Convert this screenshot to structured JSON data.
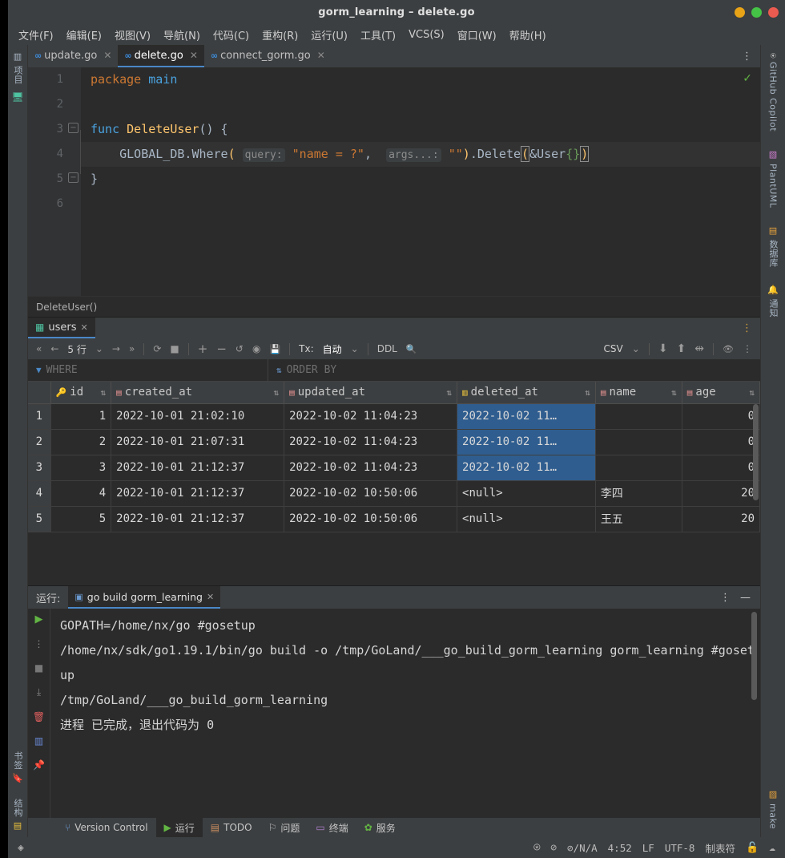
{
  "window": {
    "title": "gorm_learning – delete.go",
    "buttons": [
      "minimize",
      "maximize",
      "close"
    ]
  },
  "menubar": {
    "items": [
      {
        "label": "文件(F)"
      },
      {
        "label": "编辑(E)"
      },
      {
        "label": "视图(V)"
      },
      {
        "label": "导航(N)"
      },
      {
        "label": "代码(C)"
      },
      {
        "label": "重构(R)"
      },
      {
        "label": "运行(U)"
      },
      {
        "label": "工具(T)"
      },
      {
        "label": "VCS(S)"
      },
      {
        "label": "窗口(W)"
      },
      {
        "label": "帮助(H)"
      }
    ]
  },
  "left_toolbar": {
    "top_label": "项目",
    "bottom_labels": [
      "书签",
      "结构"
    ]
  },
  "right_toolbar": {
    "items": [
      "GitHub Copilot",
      "PlantUML",
      "数据库",
      "通知"
    ],
    "bottom": [
      "make"
    ]
  },
  "editor": {
    "tabs": [
      {
        "label": "update.go",
        "active": false
      },
      {
        "label": "delete.go",
        "active": true
      },
      {
        "label": "connect_gorm.go",
        "active": false
      }
    ],
    "more_label": "⋮",
    "lines": [
      "1",
      "2",
      "3",
      "4",
      "5",
      "6"
    ],
    "code": {
      "l1_kw": "package",
      "l1_id": "main",
      "l3_kw": "func",
      "l3_fn": "DeleteUser",
      "l3_paren": "() {",
      "l4_recv": "GLOBAL_DB",
      "l4_dot1": ".",
      "l4_where": "Where",
      "l4_open": "(",
      "l4_hint1": "query:",
      "l4_str1": "\"name = ?\"",
      "l4_comma": ",",
      "l4_hint2": "args...:",
      "l4_str2": "\"\"",
      "l4_close": ")",
      "l4_dot2": ".",
      "l4_delete": "Delete",
      "l4_open2": "(",
      "l4_arg": "&User",
      "l4_braces": "{}",
      "l4_close2": ")",
      "l5_brace": "}"
    },
    "breadcrumb": "DeleteUser()"
  },
  "database": {
    "tab": {
      "label": "users",
      "icon": "table-icon"
    },
    "toolbar": {
      "first": "«",
      "prev": "←",
      "rowcount": "5 行",
      "rowcount_caret": "⌄",
      "next": "→",
      "last": "»",
      "refresh": "⟳",
      "stop": "■",
      "add": "+",
      "remove": "−",
      "revert": "↺",
      "view": "◉",
      "save": "💾",
      "tx_label": "Tx:",
      "tx_value": "自动",
      "tx_caret": "⌄",
      "ddl": "DDL",
      "search": "🔍",
      "format": "CSV",
      "format_caret": "⌄",
      "download": "⬇",
      "upload": "⬆",
      "compare": "⇹",
      "eye": "👁",
      "more": "⋮"
    },
    "filters": {
      "where_label": "WHERE",
      "orderby_label": "ORDER BY"
    },
    "columns": [
      {
        "name": "id",
        "icon": "key-icon"
      },
      {
        "name": "created_at",
        "icon": "column-icon"
      },
      {
        "name": "updated_at",
        "icon": "column-icon"
      },
      {
        "name": "deleted_at",
        "icon": "indexed-column-icon"
      },
      {
        "name": "name",
        "icon": "column-icon"
      },
      {
        "name": "age",
        "icon": "column-icon"
      }
    ],
    "rows": [
      {
        "n": "1",
        "id": "1",
        "created_at": "2022-10-01 21:02:10",
        "updated_at": "2022-10-02 11:04:23",
        "deleted_at": "2022-10-02 11…",
        "deleted_selected": true,
        "name": "",
        "age": "0"
      },
      {
        "n": "2",
        "id": "2",
        "created_at": "2022-10-01 21:07:31",
        "updated_at": "2022-10-02 11:04:23",
        "deleted_at": "2022-10-02 11…",
        "deleted_selected": true,
        "name": "",
        "age": "0"
      },
      {
        "n": "3",
        "id": "3",
        "created_at": "2022-10-01 21:12:37",
        "updated_at": "2022-10-02 11:04:23",
        "deleted_at": "2022-10-02 11…",
        "deleted_selected": true,
        "name": "",
        "age": "0"
      },
      {
        "n": "4",
        "id": "4",
        "created_at": "2022-10-01 21:12:37",
        "updated_at": "2022-10-02 10:50:06",
        "deleted_at": "<null>",
        "deleted_selected": false,
        "name": "李四",
        "age": "20"
      },
      {
        "n": "5",
        "id": "5",
        "created_at": "2022-10-01 21:12:37",
        "updated_at": "2022-10-02 10:50:06",
        "deleted_at": "<null>",
        "deleted_selected": false,
        "name": "王五",
        "age": "20"
      }
    ]
  },
  "run": {
    "label": "运行:",
    "tab_label": "go build gorm_learning",
    "more": "⋮",
    "minimize": "—",
    "console_lines": [
      "GOPATH=/home/nx/go #gosetup",
      "/home/nx/sdk/go1.19.1/bin/go build -o /tmp/GoLand/___go_build_gorm_learning gorm_learning #gosetup",
      "/tmp/GoLand/___go_build_gorm_learning",
      "",
      "进程 已完成，退出代码为 0"
    ]
  },
  "toolwindow_bar": {
    "items": [
      {
        "label": "Version Control",
        "icon": "branch-icon",
        "active": false
      },
      {
        "label": "运行",
        "icon": "play-icon",
        "active": true
      },
      {
        "label": "TODO",
        "icon": "todo-icon",
        "active": false
      },
      {
        "label": "问题",
        "icon": "problems-icon",
        "active": false
      },
      {
        "label": "终端",
        "icon": "terminal-icon",
        "active": false
      },
      {
        "label": "服务",
        "icon": "services-icon",
        "active": false
      }
    ]
  },
  "statusbar": {
    "left_icon": "stack-icon",
    "right": {
      "copilot": "github-copilot-icon",
      "inspection": "⊘",
      "errors": "⊘/N/A",
      "caret": "4:52",
      "line_sep": "LF",
      "encoding": "UTF-8",
      "indent": "制表符",
      "lock": "🔓",
      "cloud": "☁"
    }
  },
  "colors": {
    "accent": "#4a88c7",
    "selection": "#2f5d8f",
    "keyword": "#cc7832",
    "string": "#6a8759",
    "function": "#ffc66d",
    "null": "#629755",
    "panel": "#3c3f41",
    "background": "#2b2b2b"
  }
}
